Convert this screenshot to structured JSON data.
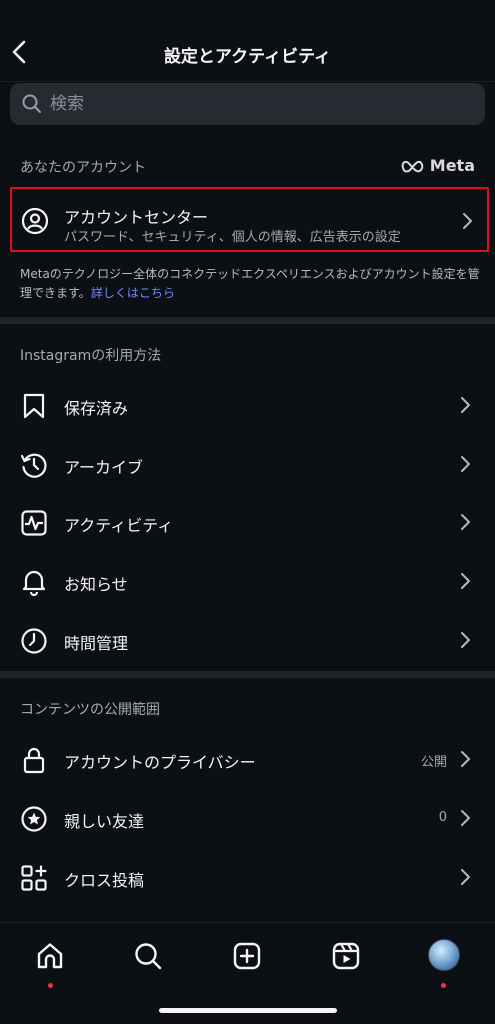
{
  "header": {
    "title": "設定とアクティビティ"
  },
  "search": {
    "placeholder": "検索"
  },
  "your_account": {
    "label": "あなたのアカウント",
    "meta_logo": "Meta",
    "account_center": {
      "title": "アカウントセンター",
      "subtitle": "パスワード、セキュリティ、個人の情報、広告表示の設定"
    },
    "description": "Metaのテクノロジー全体のコネクテッドエクスペリエンスおよびアカウント設定を管理できます。",
    "learn_more": "詳しくはこちら"
  },
  "how_you_use": {
    "label": "Instagramの利用方法",
    "items": [
      {
        "label": "保存済み",
        "icon": "bookmark-icon"
      },
      {
        "label": "アーカイブ",
        "icon": "archive-icon"
      },
      {
        "label": "アクティビティ",
        "icon": "activity-icon"
      },
      {
        "label": "お知らせ",
        "icon": "bell-icon"
      },
      {
        "label": "時間管理",
        "icon": "clock-icon"
      }
    ]
  },
  "who_can_see": {
    "label": "コンテンツの公開範囲",
    "items": [
      {
        "label": "アカウントのプライバシー",
        "value": "公開",
        "icon": "lock-icon"
      },
      {
        "label": "親しい友達",
        "value": "0",
        "icon": "star-icon"
      },
      {
        "label": "クロス投稿",
        "value": "",
        "icon": "cross-post-icon"
      }
    ]
  },
  "tabbar": {
    "tabs": [
      "home-icon",
      "search-icon",
      "create-icon",
      "reels-icon",
      "profile-avatar"
    ]
  },
  "colors": {
    "accent_link": "#6f8cff",
    "highlight_border": "#e0101a",
    "notification_dot": "#ff2a44"
  }
}
